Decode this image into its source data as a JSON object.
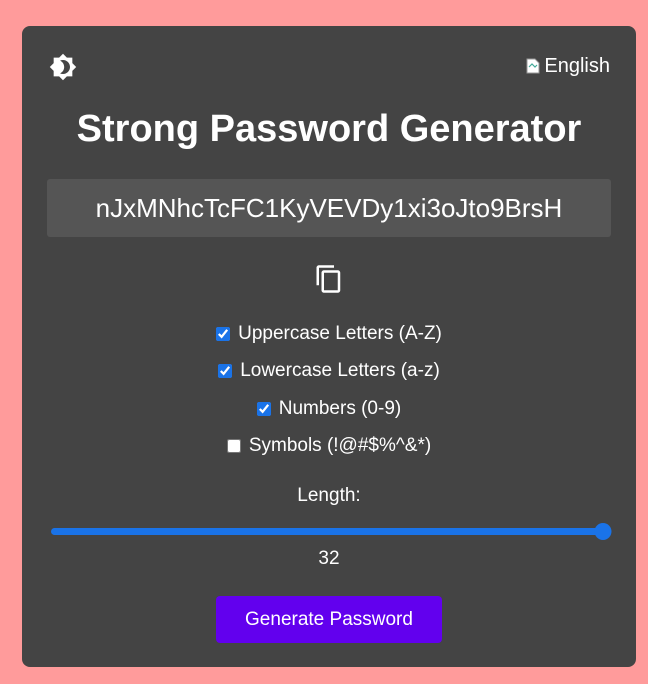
{
  "header": {
    "language_label": "English",
    "theme_icon": "brightness-icon"
  },
  "title": "Strong Password Generator",
  "password": {
    "value": "nJxMNhcTcFC1KyVEVDy1xi3oJto9BrsH"
  },
  "copy_icon": "copy-icon",
  "options": [
    {
      "label": "Uppercase Letters (A-Z)",
      "checked": true
    },
    {
      "label": "Lowercase Letters (a-z)",
      "checked": true
    },
    {
      "label": "Numbers (0-9)",
      "checked": true
    },
    {
      "label": "Symbols (!@#$%^&*)",
      "checked": false
    }
  ],
  "length": {
    "label": "Length:",
    "value": "32",
    "min": 4,
    "max": 32
  },
  "generate_button": "Generate Password",
  "colors": {
    "page_bg": "#ff9b9b",
    "card_bg": "#444444",
    "input_bg": "#555555",
    "accent": "#1a73e8",
    "button": "#6200ee"
  }
}
